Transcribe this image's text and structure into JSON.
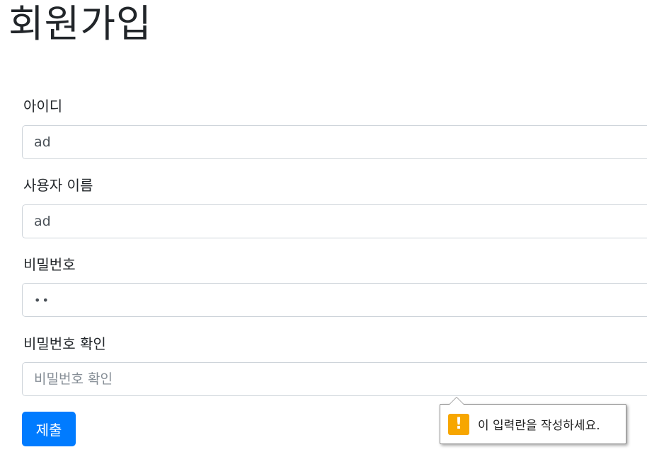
{
  "page": {
    "title": "회원가입"
  },
  "form": {
    "fields": [
      {
        "label": "아이디",
        "value": "ad",
        "placeholder": ""
      },
      {
        "label": "사용자 이름",
        "value": "ad",
        "placeholder": ""
      },
      {
        "label": "비밀번호",
        "value": "••",
        "placeholder": ""
      },
      {
        "label": "비밀번호 확인",
        "value": "",
        "placeholder": "비밀번호 확인"
      }
    ],
    "submit_label": "제출"
  },
  "validation": {
    "message": "이 입력란을 작성하세요.",
    "icon": "warning-icon"
  },
  "colors": {
    "primary": "#007bff",
    "warning": "#f7a600",
    "input_border": "#ced4da"
  }
}
